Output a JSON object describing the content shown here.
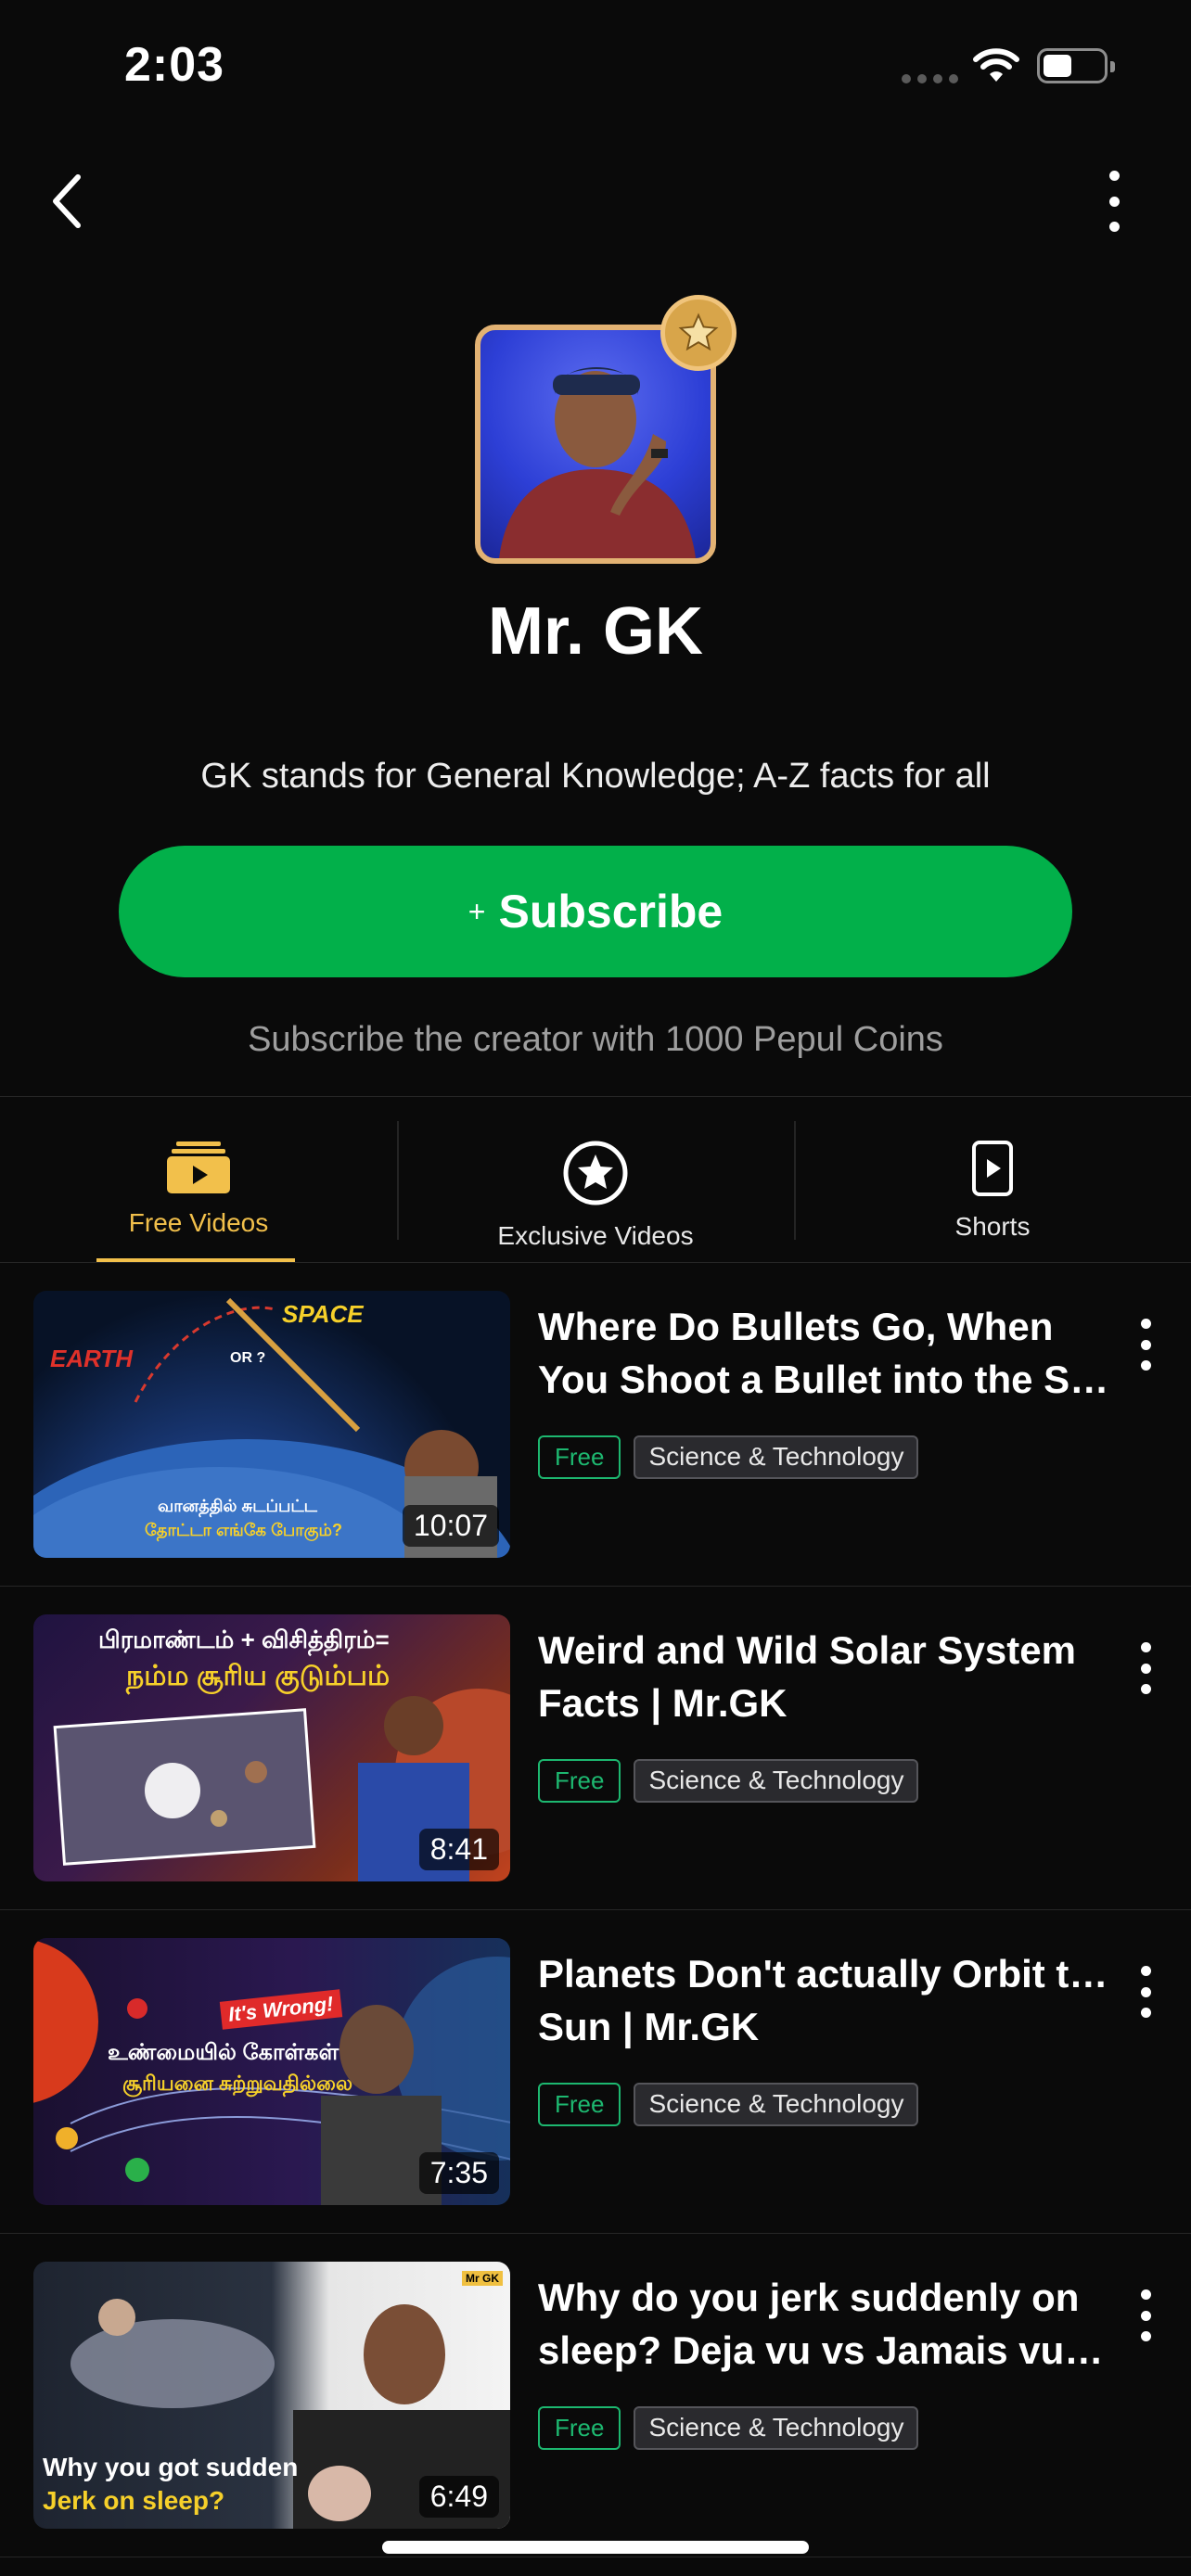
{
  "status_bar": {
    "time": "2:03"
  },
  "profile": {
    "name": "Mr. GK",
    "bio": "GK stands for General Knowledge; A-Z facts for all",
    "subscribe_plus": "+",
    "subscribe_label": "Subscribe",
    "subscribe_note": "Subscribe the creator with 1000 Pepul Coins"
  },
  "tabs": [
    {
      "label": "Free Videos",
      "icon": "video-folder-icon",
      "active": true
    },
    {
      "label": "Exclusive Videos",
      "icon": "star-circle-icon",
      "active": false
    },
    {
      "label": "Shorts",
      "icon": "play-card-icon",
      "active": false
    }
  ],
  "videos": [
    {
      "title_line1": "Where Do Bullets Go, When",
      "title_line2": "You Shoot a Bullet into the Sk…",
      "duration": "10:07",
      "free": "Free",
      "category": "Science & Technology",
      "thumb_text": [
        "SPACE",
        "EARTH",
        "OR ?",
        "வானத்தில் சுடப்பட்ட",
        "தோட்டா எங்கே போகும்?"
      ]
    },
    {
      "title_line1": "Weird and Wild Solar System",
      "title_line2": "Facts | Mr.GK",
      "duration": "8:41",
      "free": "Free",
      "category": "Science & Technology",
      "thumb_text": [
        "பிரமாண்டம் + விசித்திரம்=",
        "நம்ம சூரிய குடும்பம்"
      ]
    },
    {
      "title_line1": "Planets Don't actually Orbit the",
      "title_line2": "Sun  | Mr.GK",
      "duration": "7:35",
      "free": "Free",
      "category": "Science & Technology",
      "thumb_text": [
        "It's Wrong!",
        "உண்மையில் கோள்கள்",
        "சூரியனை சுற்றுவதில்லை"
      ]
    },
    {
      "title_line1": "Why do you jerk suddenly on",
      "title_line2": "sleep? Deja vu vs Jamais vu |…",
      "duration": "6:49",
      "free": "Free",
      "category": "Science & Technology",
      "thumb_text": [
        "Why you got sudden",
        "Jerk on  sleep?",
        "Mr GK"
      ]
    }
  ]
}
